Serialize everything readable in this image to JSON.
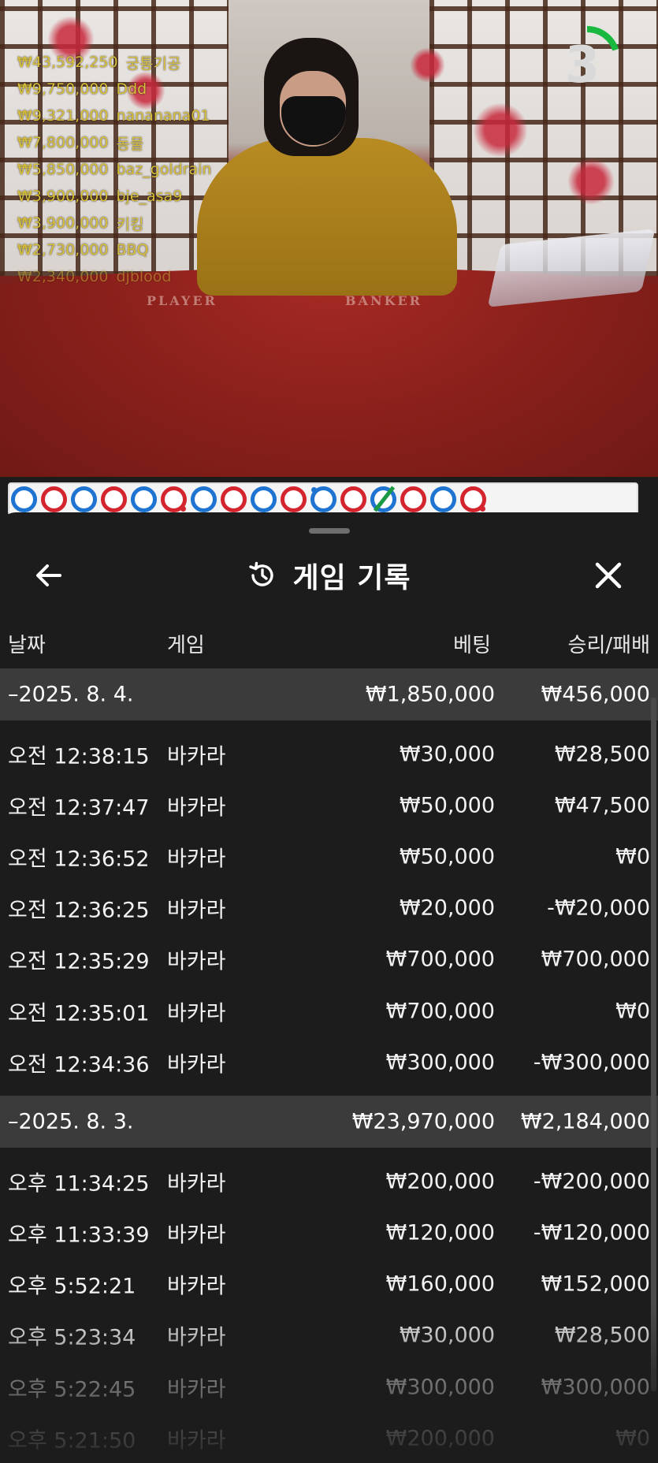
{
  "leaderboard": [
    {
      "amount": "₩43,592,250",
      "name": "궁통기공"
    },
    {
      "amount": "₩9,750,000",
      "name": "Ddd"
    },
    {
      "amount": "₩9,321,000",
      "name": "nananana01"
    },
    {
      "amount": "₩7,800,000",
      "name": "동물"
    },
    {
      "amount": "₩5,850,000",
      "name": "baz_goldrain"
    },
    {
      "amount": "₩3,900,000",
      "name": "bje_asa9"
    },
    {
      "amount": "₩3,900,000",
      "name": "키킹"
    },
    {
      "amount": "₩2,730,000",
      "name": "BBQ"
    },
    {
      "amount": "₩2,340,000",
      "name": "djblood"
    }
  ],
  "timer": {
    "seconds": "3",
    "remaining_fraction": 0.2
  },
  "table_labels": {
    "player": "PLAYER",
    "banker": "BANKER"
  },
  "road": [
    "P",
    "B",
    "P",
    "B",
    "P",
    "B",
    "P",
    "B",
    "P",
    "B",
    "P",
    "B",
    "P",
    "B",
    "P",
    "B"
  ],
  "header": {
    "title": "게임 기록"
  },
  "columns": {
    "date": "날짜",
    "game": "게임",
    "bet": "베팅",
    "winloss": "승리/패배"
  },
  "groups": [
    {
      "date": "–2025. 8. 4.",
      "bet_total": "₩1,850,000",
      "win_total": "₩456,000",
      "items": [
        {
          "time": "오전 12:38:15",
          "game": "바카라",
          "bet": "₩30,000",
          "win": "₩28,500"
        },
        {
          "time": "오전 12:37:47",
          "game": "바카라",
          "bet": "₩50,000",
          "win": "₩47,500"
        },
        {
          "time": "오전 12:36:52",
          "game": "바카라",
          "bet": "₩50,000",
          "win": "₩0"
        },
        {
          "time": "오전 12:36:25",
          "game": "바카라",
          "bet": "₩20,000",
          "win": "-₩20,000"
        },
        {
          "time": "오전 12:35:29",
          "game": "바카라",
          "bet": "₩700,000",
          "win": "₩700,000"
        },
        {
          "time": "오전 12:35:01",
          "game": "바카라",
          "bet": "₩700,000",
          "win": "₩0"
        },
        {
          "time": "오전 12:34:36",
          "game": "바카라",
          "bet": "₩300,000",
          "win": "-₩300,000"
        }
      ]
    },
    {
      "date": "–2025. 8. 3.",
      "bet_total": "₩23,970,000",
      "win_total": "₩2,184,000",
      "items": [
        {
          "time": "오후 11:34:25",
          "game": "바카라",
          "bet": "₩200,000",
          "win": "-₩200,000"
        },
        {
          "time": "오후 11:33:39",
          "game": "바카라",
          "bet": "₩120,000",
          "win": "-₩120,000"
        },
        {
          "time": "오후 5:52:21",
          "game": "바카라",
          "bet": "₩160,000",
          "win": "₩152,000"
        },
        {
          "time": "오후 5:23:34",
          "game": "바카라",
          "bet": "₩30,000",
          "win": "₩28,500"
        },
        {
          "time": "오후 5:22:45",
          "game": "바카라",
          "bet": "₩300,000",
          "win": "₩300,000"
        },
        {
          "time": "오후 5:21:50",
          "game": "바카라",
          "bet": "₩200,000",
          "win": "₩0"
        }
      ]
    }
  ],
  "colors": {
    "player": "#1e74d0",
    "banker": "#d4252f",
    "tie": "#1a9a45",
    "leaderboard": "#d8bf3a",
    "timer": "#19b83f"
  }
}
